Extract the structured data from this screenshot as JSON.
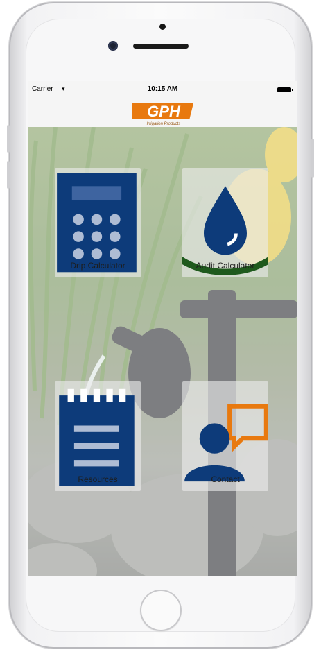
{
  "status_bar": {
    "carrier": "Carrier",
    "time": "10:15 AM"
  },
  "header": {
    "logo_text": "GPH",
    "logo_subtitle": "Irrigation Products"
  },
  "tiles": [
    {
      "label": "Drip Calculator",
      "icon": "calculator-icon"
    },
    {
      "label": "Audit Calculator",
      "icon": "water-drop-icon"
    },
    {
      "label": "Resources",
      "icon": "notepad-icon"
    },
    {
      "label": "Contact",
      "icon": "person-chat-icon"
    }
  ],
  "colors": {
    "icon_navy": "#0d3b7a",
    "logo_orange": "#e8790f",
    "audit_green": "#1f5a1d"
  }
}
